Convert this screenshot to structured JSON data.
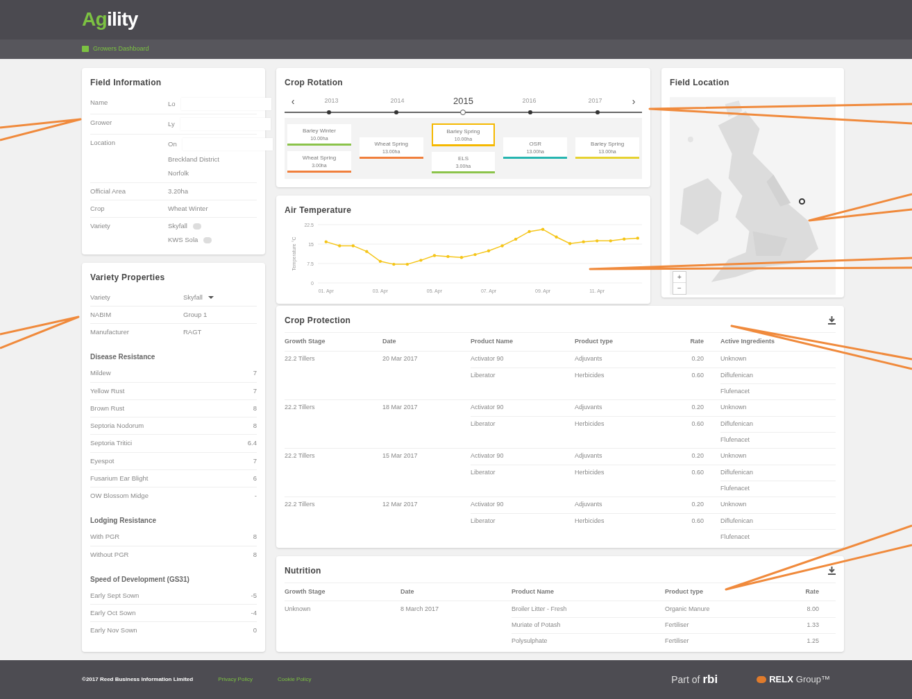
{
  "header": {
    "logo_accent": "Ag",
    "logo_rest": "ility",
    "nav": [
      {
        "label": "Growers Dashboard",
        "selected": true
      }
    ]
  },
  "field_information": {
    "title": "Field Information",
    "rows": [
      {
        "label": "Name",
        "values": [
          {
            "text": "Lo",
            "kind": "redacted"
          }
        ]
      },
      {
        "label": "Grower",
        "values": [
          {
            "text": "Ly",
            "kind": "redacted"
          }
        ]
      },
      {
        "label": "Location",
        "values": [
          {
            "text": "On",
            "kind": "redacted"
          },
          {
            "text": "Breckland District",
            "kind": "plain"
          },
          {
            "text": "Norfolk",
            "kind": "plain"
          }
        ]
      },
      {
        "label": "Official Area",
        "values": [
          {
            "text": "3.20ha",
            "kind": "plain"
          }
        ]
      },
      {
        "label": "Crop",
        "values": [
          {
            "text": "Wheat Winter",
            "kind": "plain"
          }
        ]
      },
      {
        "label": "Variety",
        "values": [
          {
            "text": "Skyfall",
            "kind": "badge"
          },
          {
            "text": "KWS Sola",
            "kind": "badge"
          }
        ]
      }
    ]
  },
  "variety_properties": {
    "title": "Variety Properties",
    "details": [
      {
        "label": "Variety",
        "value": "Skyfall",
        "kind": "dropdown"
      },
      {
        "label": "NABIM",
        "value": "Group 1",
        "kind": "text"
      },
      {
        "label": "Manufacturer",
        "value": "RAGT",
        "kind": "text"
      }
    ],
    "sections": [
      {
        "title": "Disease Resistance",
        "rows": [
          {
            "label": "Mildew",
            "value": "7"
          },
          {
            "label": "Yellow Rust",
            "value": "7"
          },
          {
            "label": "Brown Rust",
            "value": "8"
          },
          {
            "label": "Septoria Nodorum",
            "value": "8"
          },
          {
            "label": "Septoria Tritici",
            "value": "6.4"
          },
          {
            "label": "Eyespot",
            "value": "7"
          },
          {
            "label": "Fusarium Ear Blight",
            "value": "6"
          },
          {
            "label": "OW Blossom Midge",
            "value": "-"
          }
        ]
      },
      {
        "title": "Lodging Resistance",
        "rows": [
          {
            "label": "With PGR",
            "value": "8"
          },
          {
            "label": "Without PGR",
            "value": "8"
          }
        ]
      },
      {
        "title": "Speed of Development (GS31)",
        "rows": [
          {
            "label": "Early Sept Sown",
            "value": "-5"
          },
          {
            "label": "Early Oct Sown",
            "value": "-4"
          },
          {
            "label": "Early Nov Sown",
            "value": "0"
          }
        ]
      }
    ]
  },
  "crop_rotation": {
    "title": "Crop Rotation",
    "prev": "‹",
    "next": "›",
    "years": [
      {
        "label": "2013",
        "selected": false,
        "crops": [
          {
            "name": "Barley Winter",
            "area": "10.00ha",
            "color": "#8bc34a",
            "selected": false
          },
          {
            "name": "Wheat Spring",
            "area": "3.00ha",
            "color": "#f07f3c",
            "selected": false
          }
        ]
      },
      {
        "label": "2014",
        "selected": false,
        "crops": [
          {
            "name": "Wheat Spring",
            "area": "13.00ha",
            "color": "#f07f3c",
            "selected": false
          }
        ]
      },
      {
        "label": "2015",
        "selected": true,
        "crops": [
          {
            "name": "Barley Spring",
            "area": "10.00ha",
            "color": "#f5b800",
            "selected": true
          },
          {
            "name": "ELS",
            "area": "3.00ha",
            "color": "#8bc34a",
            "selected": false
          }
        ]
      },
      {
        "label": "2016",
        "selected": false,
        "crops": [
          {
            "name": "OSR",
            "area": "13.00ha",
            "color": "#26b5b0",
            "selected": false
          }
        ]
      },
      {
        "label": "2017",
        "selected": false,
        "crops": [
          {
            "name": "Barley Spring",
            "area": "13.00ha",
            "color": "#e6d230",
            "selected": false
          }
        ]
      }
    ]
  },
  "air_temperature": {
    "title": "Air Temperature",
    "chart_data": {
      "type": "line",
      "ylabel": "Temperature °C",
      "categories": [
        "01. Apr",
        null,
        null,
        null,
        "03. Apr",
        null,
        null,
        null,
        "05. Apr",
        null,
        null,
        null,
        "07. Apr",
        null,
        null,
        null,
        "09. Apr",
        null,
        null,
        null,
        "11. Apr",
        null,
        null,
        null
      ],
      "series": [
        {
          "color": "#f5c518",
          "values": [
            15.9,
            14.35,
            14.35,
            12.15,
            8.35,
            7.2,
            7.2,
            8.75,
            10.6,
            10.2,
            9.85,
            10.95,
            12.4,
            14.35,
            16.9,
            19.85,
            20.7,
            17.75,
            15.2,
            15.9,
            16.25,
            16.25,
            16.95,
            17.3
          ]
        }
      ],
      "ylim": [
        0,
        22.5
      ],
      "yticks": [
        0,
        {
          "value": 7.5,
          "label": "7.5"
        },
        15,
        {
          "value": 22.5,
          "label": "22.5"
        }
      ]
    }
  },
  "field_location": {
    "title": "Field Location",
    "zoom_in": "+",
    "zoom_out": "−"
  },
  "crop_protection": {
    "title": "Crop Protection",
    "columns": [
      "Growth Stage",
      "Date",
      "Product Name",
      "Product type",
      "Rate",
      "Active Ingredients"
    ],
    "applications": [
      {
        "growth_stage": "22.2 Tillers",
        "date": "20 Mar 2017",
        "products": [
          {
            "name": "Activator 90",
            "type": "Adjuvants",
            "rate": "0.20",
            "ingredients": [
              "Unknown"
            ]
          },
          {
            "name": "Liberator",
            "type": "Herbicides",
            "rate": "0.60",
            "ingredients": [
              "Diflufenican",
              "Flufenacet"
            ]
          }
        ]
      },
      {
        "growth_stage": "22.2 Tillers",
        "date": "18 Mar 2017",
        "products": [
          {
            "name": "Activator 90",
            "type": "Adjuvants",
            "rate": "0.20",
            "ingredients": [
              "Unknown"
            ]
          },
          {
            "name": "Liberator",
            "type": "Herbicides",
            "rate": "0.60",
            "ingredients": [
              "Diflufenican",
              "Flufenacet"
            ]
          }
        ]
      },
      {
        "growth_stage": "22.2 Tillers",
        "date": "15 Mar 2017",
        "products": [
          {
            "name": "Activator 90",
            "type": "Adjuvants",
            "rate": "0.20",
            "ingredients": [
              "Unknown"
            ]
          },
          {
            "name": "Liberator",
            "type": "Herbicides",
            "rate": "0.60",
            "ingredients": [
              "Diflufenican",
              "Flufenacet"
            ]
          }
        ]
      },
      {
        "growth_stage": "22.2 Tillers",
        "date": "12 Mar 2017",
        "products": [
          {
            "name": "Activator 90",
            "type": "Adjuvants",
            "rate": "0.20",
            "ingredients": [
              "Unknown"
            ]
          },
          {
            "name": "Liberator",
            "type": "Herbicides",
            "rate": "0.60",
            "ingredients": [
              "Diflufenican",
              "Flufenacet"
            ]
          }
        ]
      }
    ]
  },
  "nutrition": {
    "title": "Nutrition",
    "columns": [
      "Growth Stage",
      "Date",
      "Product Name",
      "Product type",
      "Rate"
    ],
    "applications": [
      {
        "growth_stage": "Unknown",
        "date": "8 March 2017",
        "products": [
          {
            "name": "Broiler Litter - Fresh",
            "type": "Organic Manure",
            "rate": "8.00"
          },
          {
            "name": "Muriate of Potash",
            "type": "Fertiliser",
            "rate": "1.33"
          },
          {
            "name": "Polysulphate",
            "type": "Fertiliser",
            "rate": "1.25"
          }
        ]
      }
    ]
  },
  "footer": {
    "copyright": "©2017 Reed Business Information Limited",
    "links": [
      "Privacy Policy",
      "Cookie Policy"
    ],
    "part_of": "Part of",
    "rbi": "rbi",
    "relx": "RELX",
    "group": "Group™"
  }
}
